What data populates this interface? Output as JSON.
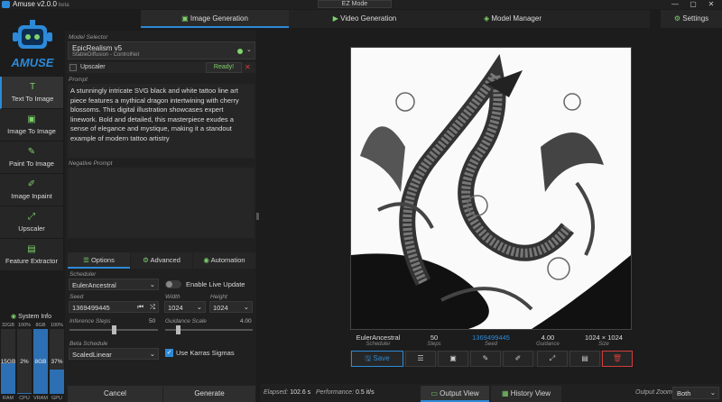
{
  "app": {
    "title": "Amuse v2.0.0",
    "beta": "beta",
    "ez_mode": "EZ Mode",
    "logo_text": "AMUSE"
  },
  "tabs": [
    {
      "label": "Image Generation"
    },
    {
      "label": "Video Generation"
    },
    {
      "label": "Model Manager"
    }
  ],
  "settings_label": "Settings",
  "nav": [
    {
      "label": "Text To Image",
      "icon": "T"
    },
    {
      "label": "Image To Image",
      "icon": "▣"
    },
    {
      "label": "Paint To Image",
      "icon": "✎"
    },
    {
      "label": "Image Inpaint",
      "icon": "✐"
    },
    {
      "label": "Upscaler",
      "icon": "⤢"
    },
    {
      "label": "Feature Extractor",
      "icon": "▤"
    }
  ],
  "system": {
    "title": "System Info",
    "bars": [
      {
        "top": "32GB",
        "value": "15GB",
        "label": "RAM",
        "fill": 0.47
      },
      {
        "top": "100%",
        "value": "2%",
        "label": "CPU",
        "fill": 0.02
      },
      {
        "top": "8GB",
        "value": "8GB",
        "label": "VRAM",
        "fill": 1.0
      },
      {
        "top": "100%",
        "value": "37%",
        "label": "GPU",
        "fill": 0.37
      }
    ]
  },
  "model": {
    "selector_label": "Model Selector",
    "name": "EpicRealism v5",
    "sub": "StableDiffusion - ControlNet",
    "upscaler_label": "Upscaler",
    "ready": "Ready!"
  },
  "prompt": {
    "label": "Prompt",
    "text": "A stunningly intricate SVG black and white tattoo line art piece features a mythical dragon intertwining with cherry blossoms. This digital illustration showcases expert linework. Bold and detailed, this masterpiece exudes a sense of elegance and mystique, making it a standout example of modern tattoo artistry",
    "negative_label": "Negative Prompt"
  },
  "subtabs": [
    {
      "label": "Options"
    },
    {
      "label": "Advanced"
    },
    {
      "label": "Automation"
    }
  ],
  "options": {
    "scheduler_label": "Scheduler",
    "scheduler": "EulerAncestral",
    "live_update": "Enable Live Update",
    "seed_label": "Seed",
    "seed": "1369499445",
    "width_label": "Width",
    "width": "1024",
    "height_label": "Height",
    "height": "1024",
    "steps_label": "Inference Steps",
    "steps": "50",
    "steps_fill": 0.5,
    "guidance_label": "Guidance Scale",
    "guidance": "4.00",
    "guidance_fill": 0.14,
    "beta_label": "Beta Schedule",
    "beta": "ScaledLinear",
    "karras": "Use Karras Sigmas"
  },
  "actions": {
    "cancel": "Cancel",
    "generate": "Generate"
  },
  "result": {
    "meta": [
      {
        "value": "EulerAncestral",
        "label": "Scheduler"
      },
      {
        "value": "50",
        "label": "Steps"
      },
      {
        "value": "1369499445",
        "label": "Seed"
      },
      {
        "value": "4.00",
        "label": "Guidance"
      },
      {
        "value": "1024 × 1024",
        "label": "Size"
      }
    ],
    "save": "Save"
  },
  "status": {
    "elapsed_label": "Elapsed:",
    "elapsed": "102.6 s",
    "perf_label": "Performance:",
    "perf": "0.5 it/s",
    "output_view": "Output View",
    "history_view": "History View",
    "zoom_label": "Output Zoom:",
    "zoom": "Both"
  },
  "colors": {
    "accent": "#2d8ad8",
    "icon_green": "#7fd36b",
    "ready_green": "#7fd36b",
    "danger": "#d23c3c"
  }
}
